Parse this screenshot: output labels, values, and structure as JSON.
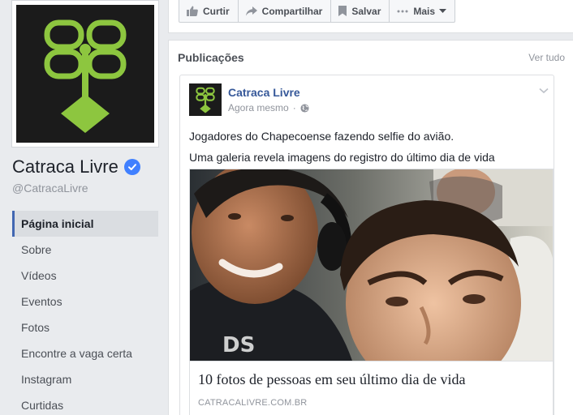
{
  "profile": {
    "logo_icon": "catraca-tree-logo",
    "name": "Catraca Livre",
    "verified_icon": "verified-check-icon",
    "handle": "@CatracaLivre"
  },
  "nav": {
    "items": [
      {
        "label": "Página inicial",
        "active": true
      },
      {
        "label": "Sobre"
      },
      {
        "label": "Vídeos"
      },
      {
        "label": "Eventos"
      },
      {
        "label": "Fotos"
      },
      {
        "label": "Encontre a vaga certa"
      },
      {
        "label": "Instagram"
      },
      {
        "label": "Curtidas"
      }
    ]
  },
  "actions": {
    "like": "Curtir",
    "share": "Compartilhar",
    "save": "Salvar",
    "more": "Mais"
  },
  "publications": {
    "heading": "Publicações",
    "see_all": "Ver tudo",
    "post": {
      "author": "Catraca Livre",
      "time": "Agora mesmo",
      "privacy_icon": "globe-icon",
      "text_line1": "Jogadores do Chapecoense fazendo selfie do avião.",
      "text_line2": "Uma galeria revela imagens do registro do último dia de vida",
      "link": {
        "title": "10 fotos de pessoas em seu último dia de vida",
        "domain": "CATRACALIVRE.COM.BR"
      }
    }
  },
  "colors": {
    "brand_green": "#8dc63f",
    "link_blue": "#365899",
    "nav_accent": "#4267b2",
    "background": "#e9ebee"
  }
}
